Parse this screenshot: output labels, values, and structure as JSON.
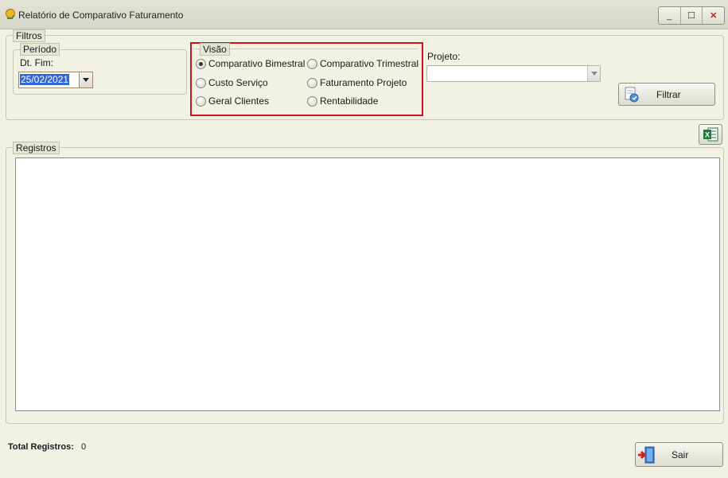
{
  "window": {
    "title": "Relatório de Comparativo Faturamento",
    "controls": [
      "_",
      "☐",
      "✕"
    ]
  },
  "filters": {
    "group_label": "Filtros",
    "period": {
      "group_label": "Período",
      "end_date_label": "Dt. Fim:",
      "end_date_value": "25/02/2021"
    },
    "view": {
      "group_label": "Visão",
      "options": [
        {
          "label": "Comparativo Bimestral",
          "checked": true
        },
        {
          "label": "Comparativo Trimestral",
          "checked": false
        },
        {
          "label": "Custo Serviço",
          "checked": false
        },
        {
          "label": "Faturamento Projeto",
          "checked": false
        },
        {
          "label": "Geral Clientes",
          "checked": false
        },
        {
          "label": "Rentabilidade",
          "checked": false
        }
      ],
      "highlight_color": "#d0131d"
    },
    "project": {
      "label": "Projeto:",
      "value": ""
    },
    "filter_button": "Filtrar"
  },
  "records": {
    "group_label": "Registros",
    "export_icon": "excel-icon"
  },
  "footer": {
    "total_label": "Total Registros:",
    "total_value": "0",
    "exit_button": "Sair"
  }
}
